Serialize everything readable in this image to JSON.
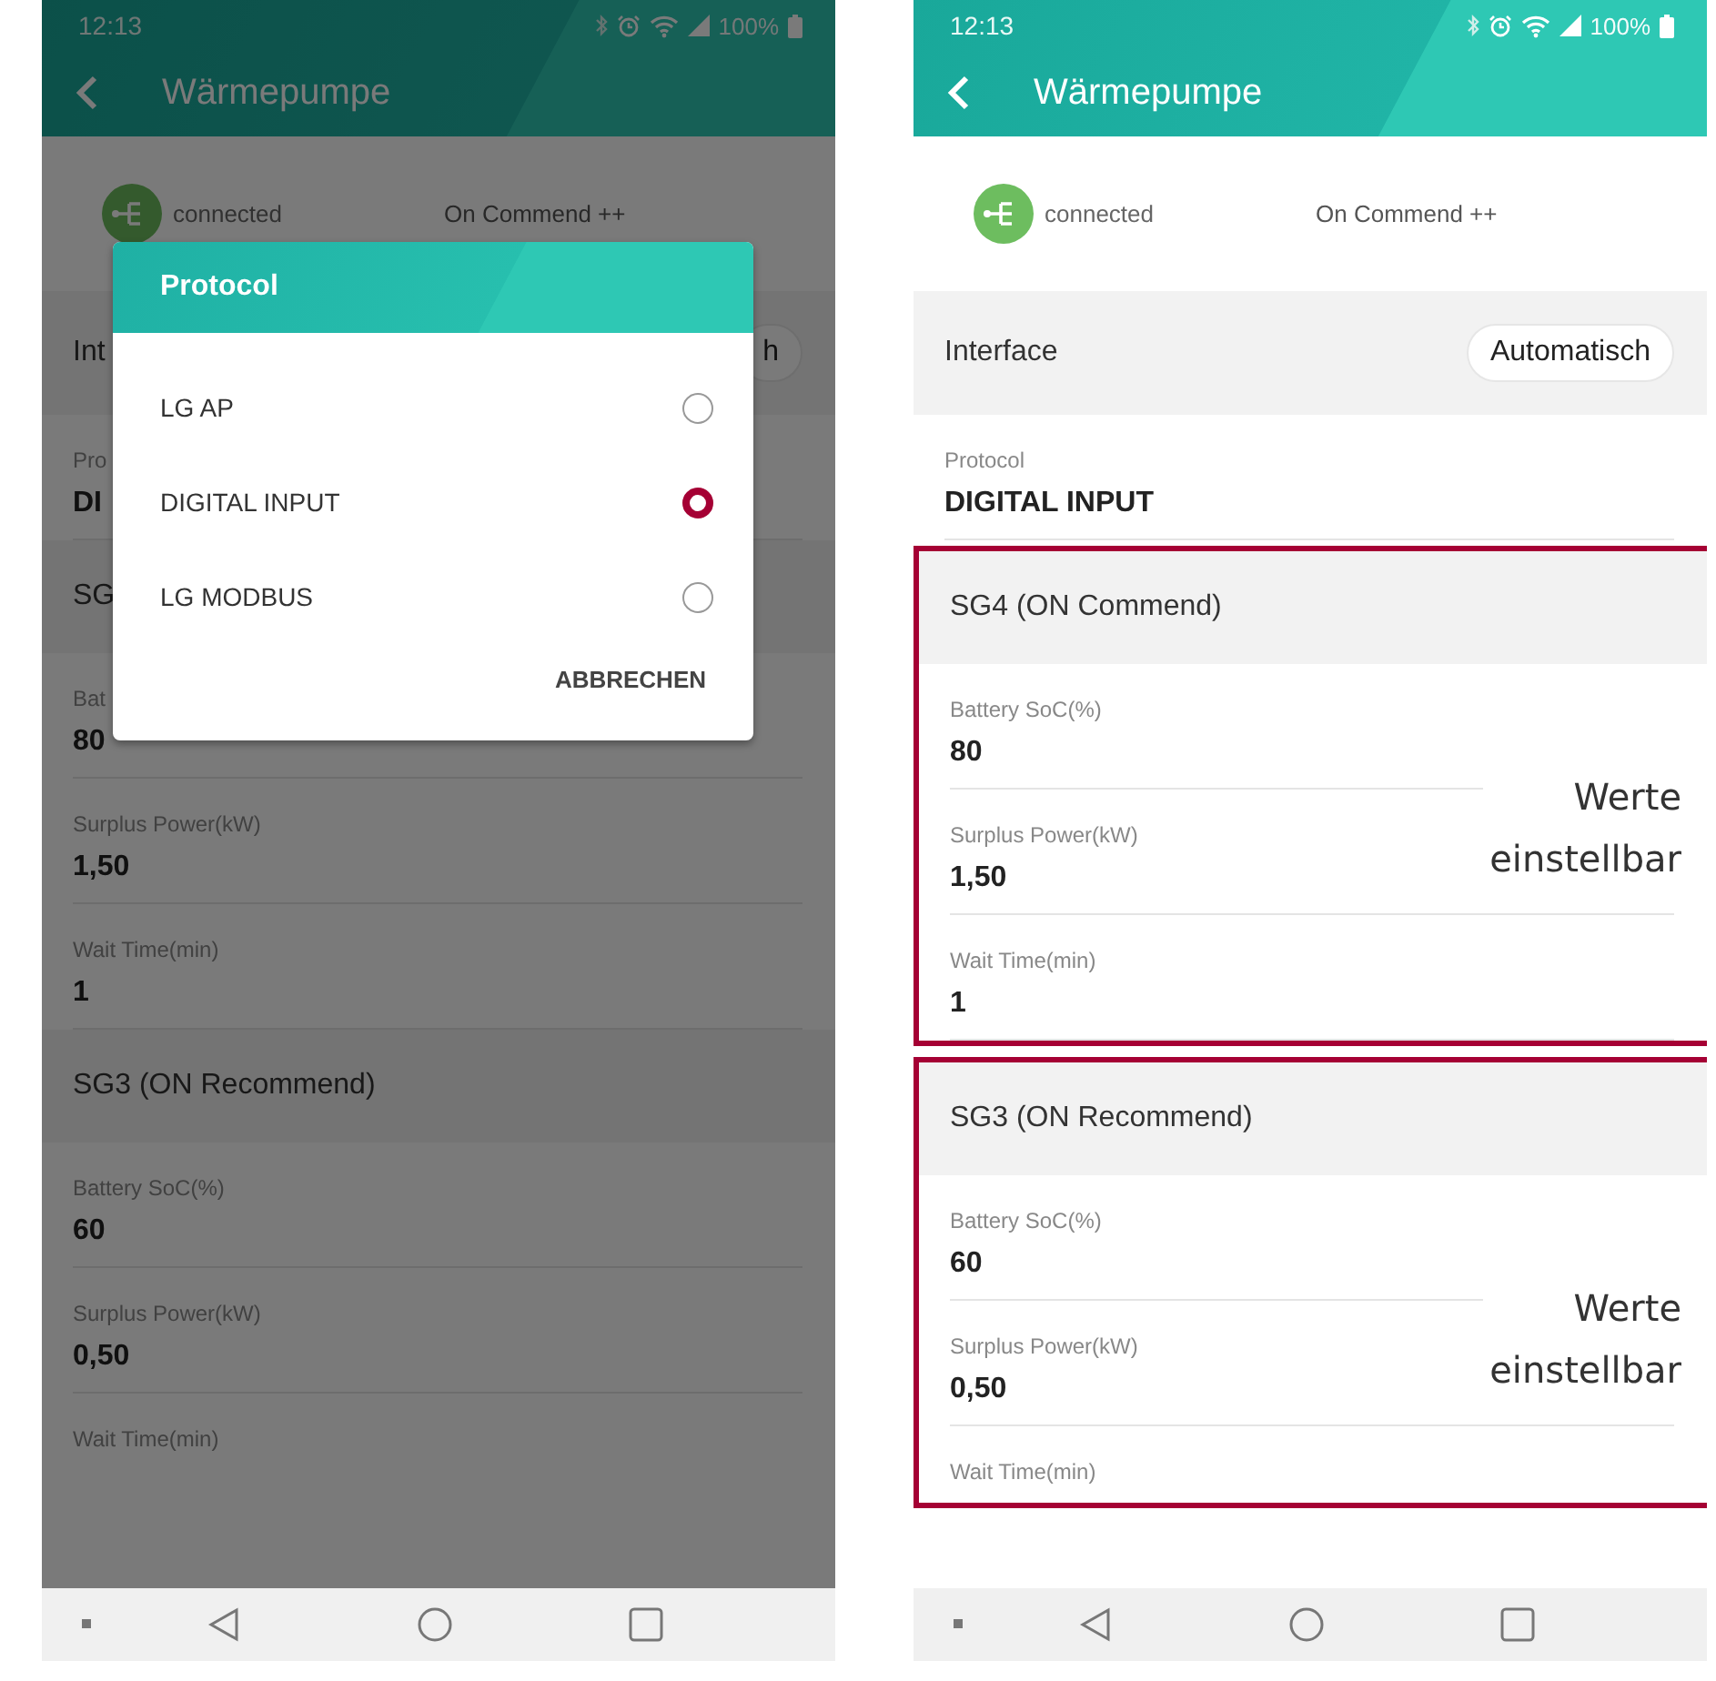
{
  "screens": [
    {
      "dimmed": true,
      "status_bar": {
        "time": "12:13",
        "battery": "100%"
      },
      "app_bar": {
        "title": "Wärmepumpe"
      },
      "connection": {
        "status": "connected",
        "mode": "On Commend ++"
      },
      "interface": {
        "label": "Int",
        "value": "h"
      },
      "protocol": {
        "label": "Pro",
        "value": "DI"
      },
      "sections": [
        {
          "title": "SG",
          "highlighted": false,
          "fields": [
            {
              "label": "Bat",
              "value": "80"
            },
            {
              "label": "Surplus Power(kW)",
              "value": "1,50"
            },
            {
              "label": "Wait Time(min)",
              "value": "1"
            }
          ]
        },
        {
          "title": "SG3 (ON Recommend)",
          "highlighted": false,
          "fields": [
            {
              "label": "Battery SoC(%)",
              "value": "60"
            },
            {
              "label": "Surplus Power(kW)",
              "value": "0,50"
            },
            {
              "label": "Wait Time(min)"
            }
          ]
        }
      ],
      "dialog": {
        "title": "Protocol",
        "options": [
          {
            "label": "LG AP",
            "selected": false
          },
          {
            "label": "DIGITAL INPUT",
            "selected": true
          },
          {
            "label": "LG MODBUS",
            "selected": false
          }
        ],
        "button": "ABBRECHEN"
      }
    },
    {
      "dimmed": false,
      "status_bar": {
        "time": "12:13",
        "battery": "100%"
      },
      "app_bar": {
        "title": "Wärmepumpe"
      },
      "connection": {
        "status": "connected",
        "mode": "On Commend ++"
      },
      "interface": {
        "label": "Interface",
        "value": "Automatisch"
      },
      "protocol": {
        "label": "Protocol",
        "value": "DIGITAL INPUT"
      },
      "sections": [
        {
          "title": "SG4 (ON Commend)",
          "highlighted": true,
          "note": "Werte einstellbar",
          "fields": [
            {
              "label": "Battery SoC(%)",
              "value": "80"
            },
            {
              "label": "Surplus Power(kW)",
              "value": "1,50"
            },
            {
              "label": "Wait Time(min)",
              "value": "1"
            }
          ]
        },
        {
          "title": "SG3 (ON Recommend)",
          "highlighted": true,
          "note": "Werte einstellbar",
          "fields": [
            {
              "label": "Battery SoC(%)",
              "value": "60"
            },
            {
              "label": "Surplus Power(kW)",
              "value": "0,50"
            },
            {
              "label": "Wait Time(min)"
            }
          ]
        }
      ]
    }
  ]
}
